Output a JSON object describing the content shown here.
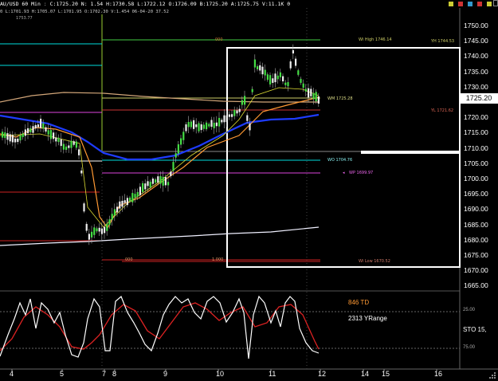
{
  "header": {
    "symbol": "AU/USD 60 Min",
    "close": "C:1725.20",
    "n": "N:",
    "n_val": "1.54",
    "high": "H:1730.58",
    "low": "L:1722.12",
    "open": "O:1726.09",
    "bid": "B:1725.20",
    "ask": "A:1725.75",
    "vol": "V:11.1K",
    "zero": "0",
    "line2": "0  L:1701.93  H:1705.07  L:1701.95  O:1702.30  V:1.454 06-04-20  37.52",
    "ref": "1753.77"
  },
  "annotations": {
    "wh_high": "Wi High 1746.14",
    "yh_high": "YH 1744.53",
    "wm": "WM 1725.28",
    "yl": "YL 1721.62",
    "wo": "WO 1704.76",
    "wp": "WP 1699.97",
    "wi_low": "Wi Low 1670.52",
    "zero_top": "000",
    "zero_bot": "000",
    "one_bot": "1.000"
  },
  "price_axis": [
    "1750.00",
    "1745.00",
    "1740.00",
    "1735.00",
    "1730.00",
    "1720.00",
    "1715.00",
    "1710.00",
    "1705.00",
    "1700.00",
    "1695.00",
    "1690.00",
    "1685.00",
    "1680.00",
    "1675.00",
    "1670.00",
    "1665.00"
  ],
  "last_price": "1725.20",
  "osc_axis": {
    "top": "25.00",
    "bottom": "75.00"
  },
  "stochastic_label": "STO  15,",
  "info": {
    "td": "846 TD",
    "yrange": "2313 YRange"
  },
  "time_axis": [
    "4",
    "5",
    "7",
    "8",
    "9",
    "10",
    "11",
    "12",
    "14",
    "15",
    "16"
  ],
  "chart_data": {
    "type": "candlestick",
    "price_range": [
      1662,
      1757
    ],
    "instrument": "AU/USD",
    "timeframe": "60 Min",
    "levels": [
      {
        "label": "Wi High",
        "value": 1746.14,
        "color": "#44cc44"
      },
      {
        "label": "YH",
        "value": 1744.53,
        "color": "#44cc44"
      },
      {
        "label": "WM",
        "value": 1725.28,
        "color": "#cccc66"
      },
      {
        "label": "YL",
        "value": 1721.62,
        "color": "#cc3333"
      },
      {
        "label": "WO",
        "value": 1704.76,
        "color": "#00dddd"
      },
      {
        "label": "WP",
        "value": 1699.97,
        "color": "#dd44dd"
      },
      {
        "label": "Wi Low",
        "value": 1670.52,
        "color": "#cc2222"
      }
    ],
    "last_close": 1725.2,
    "oscillator": "STO 15",
    "osc_range": [
      0,
      100
    ]
  }
}
